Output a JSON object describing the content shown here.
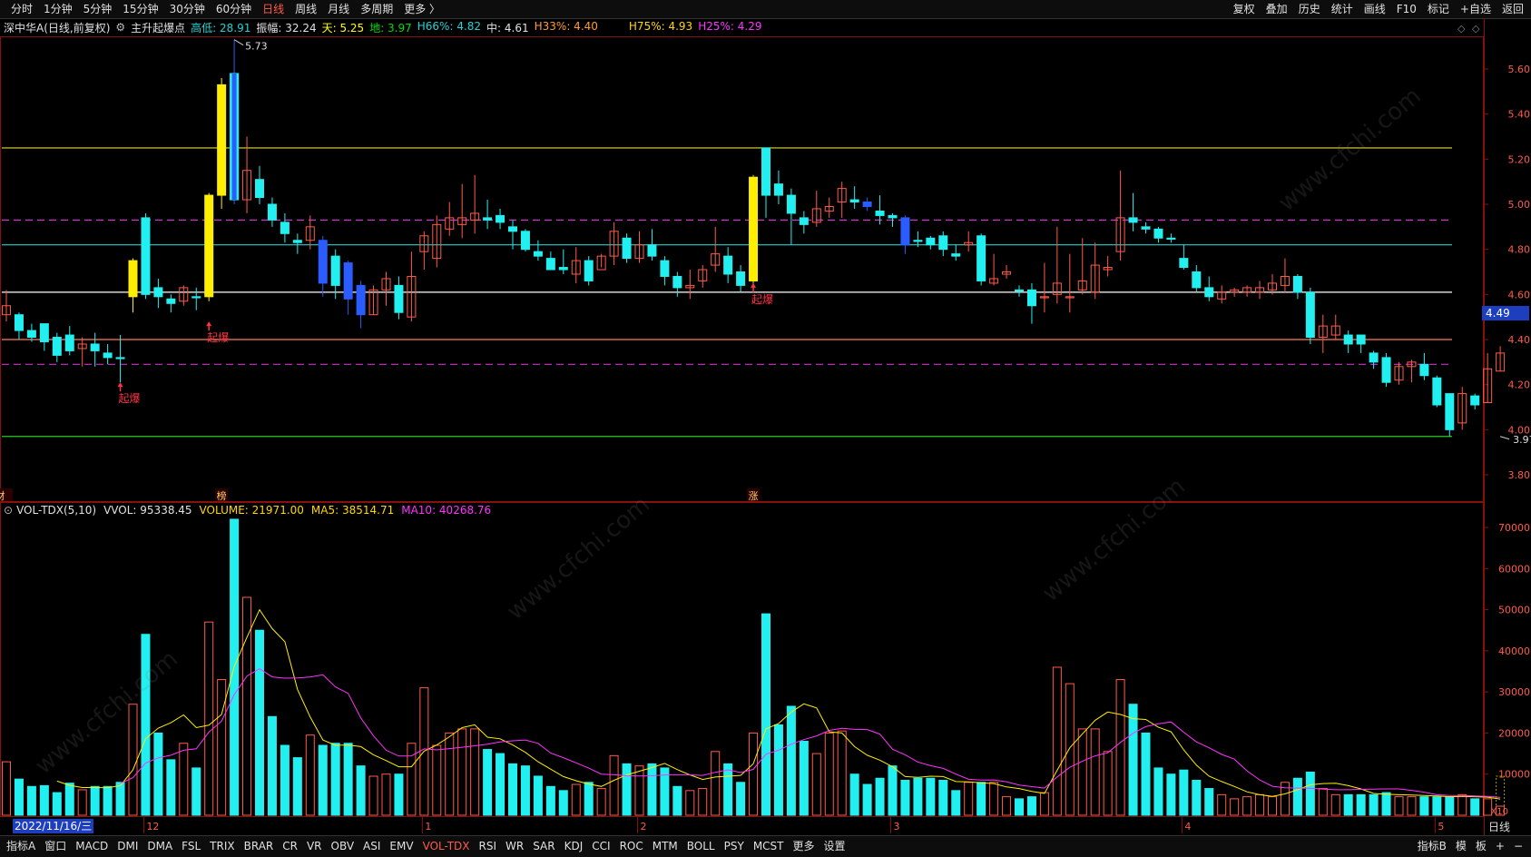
{
  "topbar": {
    "tabs": [
      "分时",
      "1分钟",
      "5分钟",
      "15分钟",
      "30分钟",
      "60分钟",
      "日线",
      "周线",
      "月线",
      "多周期",
      "更多 〉"
    ],
    "active_tab": 6,
    "right_buttons": [
      "复权",
      "叠加",
      "历史",
      "统计",
      "画线",
      "F10",
      "标记",
      "+自选",
      "返回"
    ]
  },
  "info": {
    "stock": "深中华A(日线,前复权)",
    "indicator": "主升起爆点",
    "items": [
      {
        "text": "高低: 28.91",
        "color": "#22d3d3"
      },
      {
        "text": "振幅: 32.24",
        "color": "#e0e0e0"
      },
      {
        "text": "天: 5.25",
        "color": "#ffff00"
      },
      {
        "text": "地: 3.97",
        "color": "#00dd00"
      },
      {
        "text": "H66%: 4.82",
        "color": "#22d3d3"
      },
      {
        "text": "中: 4.61",
        "color": "#e0e0e0"
      },
      {
        "text": "H33%: 4.40",
        "color": "#ff9a3a"
      },
      {
        "text": "H75%: 4.93",
        "color": "#ffd700"
      },
      {
        "text": "H25%: 4.29",
        "color": "#ff33ff"
      }
    ]
  },
  "vol_info": [
    {
      "text": "VOL-TDX(5,10)",
      "color": "#e0e0e0"
    },
    {
      "text": "VVOL: 95338.45",
      "color": "#e0e0e0"
    },
    {
      "text": "VOLUME: 21971.00",
      "color": "#ffd700"
    },
    {
      "text": "MA5: 38514.71",
      "color": "#ffd700"
    },
    {
      "text": "MA10: 40268.76",
      "color": "#ff33ff"
    }
  ],
  "price_axis": [
    "5.60",
    "5.40",
    "5.20",
    "5.00",
    "4.80",
    "4.60",
    "4.40",
    "4.20",
    "4.00",
    "3.80"
  ],
  "vol_axis": [
    "70000",
    "60000",
    "50000",
    "40000",
    "30000",
    "20000",
    "10000"
  ],
  "vol_unit": "X10",
  "current_price": "4.49",
  "high_label": "5.73",
  "low_label": "3.97",
  "signal_label": "起爆",
  "markers": [
    "榜",
    "涨",
    "财"
  ],
  "date_flag": "2022/11/16/三",
  "month_labels": [
    "12",
    "1",
    "2",
    "3",
    "4",
    "5"
  ],
  "period": "日线",
  "hlines": [
    {
      "price": 5.25,
      "color": "#e6d83a",
      "dash": false
    },
    {
      "price": 4.93,
      "color": "#cc33cc",
      "dash": true
    },
    {
      "price": 4.82,
      "color": "#22cfd0",
      "dash": false
    },
    {
      "price": 4.61,
      "color": "#ffffff",
      "dash": false
    },
    {
      "price": 4.4,
      "color": "#ff7a5a",
      "dash": false
    },
    {
      "price": 4.29,
      "color": "#cc33cc",
      "dash": true
    },
    {
      "price": 3.97,
      "color": "#22cc22",
      "dash": false
    }
  ],
  "bottom_tabs": [
    "指标A",
    "窗口",
    "MACD",
    "DMI",
    "DMA",
    "FSL",
    "TRIX",
    "BRAR",
    "CR",
    "VR",
    "OBV",
    "ASI",
    "EMV",
    "VOL-TDX",
    "RSI",
    "WR",
    "SAR",
    "KDJ",
    "CCI",
    "ROC",
    "MTM",
    "BOLL",
    "PSY",
    "MCST",
    "更多",
    "设置"
  ],
  "bottom_active": 13,
  "bottom_right": [
    "指标B",
    "模",
    "板",
    "+",
    "−"
  ],
  "chart_data": {
    "type": "candlestick",
    "ylim": [
      3.7,
      5.75
    ],
    "vol_ylim": [
      0,
      72000
    ],
    "candles": [
      [
        4.55,
        4.51,
        4.62,
        4.48,
        13000,
        "u"
      ],
      [
        4.51,
        4.44,
        4.52,
        4.4,
        8800,
        "d"
      ],
      [
        4.41,
        4.44,
        4.47,
        4.39,
        7000,
        "d"
      ],
      [
        4.47,
        4.39,
        4.47,
        4.35,
        7200,
        "d"
      ],
      [
        4.41,
        4.33,
        4.43,
        4.3,
        5500,
        "d"
      ],
      [
        4.42,
        4.35,
        4.46,
        4.33,
        7800,
        "d"
      ],
      [
        4.36,
        4.38,
        4.41,
        4.28,
        6200,
        "u"
      ],
      [
        4.38,
        4.35,
        4.43,
        4.28,
        7000,
        "d"
      ],
      [
        4.34,
        4.32,
        4.38,
        4.29,
        7000,
        "d"
      ],
      [
        4.32,
        4.32,
        4.42,
        4.21,
        8000,
        "d"
      ],
      [
        4.59,
        4.75,
        4.76,
        4.52,
        27000,
        "u"
      ],
      [
        4.94,
        4.6,
        4.96,
        4.58,
        44000,
        "d"
      ],
      [
        4.63,
        4.59,
        4.67,
        4.54,
        20000,
        "d"
      ],
      [
        4.58,
        4.56,
        4.6,
        4.52,
        13500,
        "d"
      ],
      [
        4.57,
        4.63,
        4.64,
        4.55,
        17500,
        "u"
      ],
      [
        4.59,
        4.59,
        4.63,
        4.53,
        11500,
        "d"
      ],
      [
        4.59,
        5.04,
        5.05,
        4.57,
        47000,
        "u"
      ],
      [
        5.04,
        5.53,
        5.56,
        4.98,
        33000,
        "u"
      ],
      [
        5.02,
        5.58,
        5.73,
        5.0,
        72000,
        "b"
      ],
      [
        5.02,
        5.15,
        5.3,
        4.96,
        53000,
        "u"
      ],
      [
        5.03,
        5.11,
        5.17,
        5.0,
        45000,
        "d"
      ],
      [
        5.0,
        4.93,
        5.03,
        4.9,
        24000,
        "d"
      ],
      [
        4.92,
        4.87,
        4.96,
        4.83,
        17000,
        "d"
      ],
      [
        4.84,
        4.83,
        4.87,
        4.78,
        14000,
        "d"
      ],
      [
        4.84,
        4.9,
        4.95,
        4.8,
        19500,
        "u"
      ],
      [
        4.84,
        4.65,
        4.86,
        4.59,
        17000,
        "b"
      ],
      [
        4.77,
        4.64,
        4.8,
        4.58,
        17500,
        "d"
      ],
      [
        4.74,
        4.58,
        4.75,
        4.51,
        17500,
        "b"
      ],
      [
        4.64,
        4.51,
        4.66,
        4.45,
        12000,
        "b"
      ],
      [
        4.51,
        4.62,
        4.64,
        4.51,
        9500,
        "u"
      ],
      [
        4.62,
        4.67,
        4.7,
        4.55,
        10000,
        "u"
      ],
      [
        4.64,
        4.52,
        4.68,
        4.49,
        10000,
        "d"
      ],
      [
        4.5,
        4.68,
        4.79,
        4.48,
        17500,
        "u"
      ],
      [
        4.79,
        4.86,
        4.88,
        4.71,
        31000,
        "u"
      ],
      [
        4.76,
        4.91,
        4.95,
        4.72,
        17000,
        "u"
      ],
      [
        4.89,
        4.94,
        5.01,
        4.86,
        20000,
        "u"
      ],
      [
        4.94,
        4.91,
        5.09,
        4.85,
        21000,
        "u"
      ],
      [
        4.93,
        4.96,
        5.13,
        4.87,
        21000,
        "u"
      ],
      [
        4.94,
        4.93,
        5.02,
        4.89,
        16000,
        "d"
      ],
      [
        4.95,
        4.92,
        4.98,
        4.89,
        15000,
        "d"
      ],
      [
        4.9,
        4.88,
        4.93,
        4.8,
        12500,
        "d"
      ],
      [
        4.88,
        4.8,
        4.89,
        4.79,
        12000,
        "d"
      ],
      [
        4.79,
        4.77,
        4.84,
        4.75,
        9500,
        "d"
      ],
      [
        4.76,
        4.71,
        4.79,
        4.71,
        7000,
        "d"
      ],
      [
        4.72,
        4.71,
        4.8,
        4.69,
        6000,
        "d"
      ],
      [
        4.69,
        4.75,
        4.81,
        4.65,
        7500,
        "u"
      ],
      [
        4.75,
        4.66,
        4.77,
        4.64,
        8000,
        "d"
      ],
      [
        4.71,
        4.77,
        4.78,
        4.72,
        6500,
        "u"
      ],
      [
        4.77,
        4.88,
        4.92,
        4.73,
        14500,
        "u"
      ],
      [
        4.85,
        4.76,
        4.87,
        4.74,
        12500,
        "d"
      ],
      [
        4.76,
        4.82,
        4.88,
        4.74,
        12000,
        "u"
      ],
      [
        4.82,
        4.77,
        4.89,
        4.75,
        12500,
        "d"
      ],
      [
        4.75,
        4.68,
        4.77,
        4.64,
        11500,
        "d"
      ],
      [
        4.68,
        4.63,
        4.7,
        4.59,
        7000,
        "d"
      ],
      [
        4.63,
        4.64,
        4.71,
        4.58,
        6000,
        "u"
      ],
      [
        4.66,
        4.71,
        4.73,
        4.63,
        6500,
        "u"
      ],
      [
        4.73,
        4.78,
        4.9,
        4.7,
        15500,
        "u"
      ],
      [
        4.77,
        4.69,
        4.81,
        4.65,
        12500,
        "d"
      ],
      [
        4.7,
        4.64,
        4.73,
        4.61,
        8000,
        "d"
      ],
      [
        4.66,
        5.12,
        5.13,
        4.63,
        20000,
        "u"
      ],
      [
        5.25,
        5.04,
        5.25,
        4.94,
        49000,
        "d"
      ],
      [
        5.09,
        5.04,
        5.15,
        5.0,
        22000,
        "d"
      ],
      [
        5.04,
        4.96,
        5.07,
        4.82,
        26500,
        "d"
      ],
      [
        4.94,
        4.91,
        4.97,
        4.87,
        18000,
        "d"
      ],
      [
        4.92,
        4.98,
        5.06,
        4.9,
        15000,
        "u"
      ],
      [
        4.97,
        4.99,
        5.03,
        4.94,
        20000,
        "u"
      ],
      [
        5.01,
        5.07,
        5.1,
        4.94,
        20500,
        "u"
      ],
      [
        5.02,
        5.01,
        5.08,
        4.98,
        10000,
        "d"
      ],
      [
        5.01,
        4.99,
        5.03,
        4.97,
        7500,
        "b"
      ],
      [
        4.97,
        4.95,
        5.04,
        4.91,
        9000,
        "d"
      ],
      [
        4.95,
        4.94,
        4.96,
        4.9,
        12000,
        "d"
      ],
      [
        4.94,
        4.82,
        4.95,
        4.78,
        8500,
        "b"
      ],
      [
        4.84,
        4.84,
        4.88,
        4.81,
        9000,
        "d"
      ],
      [
        4.85,
        4.82,
        4.86,
        4.8,
        9000,
        "d"
      ],
      [
        4.86,
        4.8,
        4.88,
        4.77,
        8500,
        "d"
      ],
      [
        4.78,
        4.77,
        4.82,
        4.75,
        6000,
        "d"
      ],
      [
        4.82,
        4.83,
        4.88,
        4.79,
        8000,
        "u"
      ],
      [
        4.86,
        4.66,
        4.87,
        4.64,
        8000,
        "d"
      ],
      [
        4.65,
        4.67,
        4.78,
        4.64,
        8000,
        "u"
      ],
      [
        4.7,
        4.69,
        4.73,
        4.67,
        4500,
        "u"
      ],
      [
        4.62,
        4.62,
        4.64,
        4.59,
        4000,
        "d"
      ],
      [
        4.62,
        4.55,
        4.65,
        4.47,
        4500,
        "d"
      ],
      [
        4.59,
        4.59,
        4.74,
        4.52,
        5500,
        "u"
      ],
      [
        4.6,
        4.65,
        4.9,
        4.56,
        36000,
        "u"
      ],
      [
        4.59,
        4.59,
        4.78,
        4.52,
        32000,
        "u"
      ],
      [
        4.62,
        4.66,
        4.85,
        4.6,
        21000,
        "u"
      ],
      [
        4.61,
        4.73,
        4.83,
        4.58,
        21000,
        "u"
      ],
      [
        4.72,
        4.71,
        4.77,
        4.68,
        15500,
        "u"
      ],
      [
        4.79,
        4.94,
        5.15,
        4.75,
        33000,
        "u"
      ],
      [
        4.94,
        4.92,
        5.05,
        4.88,
        27000,
        "d"
      ],
      [
        4.89,
        4.9,
        4.92,
        4.87,
        20000,
        "d"
      ],
      [
        4.89,
        4.85,
        4.9,
        4.83,
        11500,
        "d"
      ],
      [
        4.85,
        4.85,
        4.87,
        4.83,
        10000,
        "d"
      ],
      [
        4.76,
        4.72,
        4.82,
        4.71,
        11000,
        "d"
      ],
      [
        4.7,
        4.63,
        4.73,
        4.61,
        8500,
        "d"
      ],
      [
        4.63,
        4.59,
        4.68,
        4.57,
        6500,
        "d"
      ],
      [
        4.58,
        4.61,
        4.64,
        4.56,
        5000,
        "u"
      ],
      [
        4.61,
        4.62,
        4.63,
        4.59,
        4000,
        "u"
      ],
      [
        4.61,
        4.63,
        4.64,
        4.59,
        4500,
        "u"
      ],
      [
        4.63,
        4.61,
        4.66,
        4.58,
        5000,
        "u"
      ],
      [
        4.62,
        4.65,
        4.69,
        4.6,
        4500,
        "u"
      ],
      [
        4.64,
        4.68,
        4.76,
        4.61,
        8000,
        "u"
      ],
      [
        4.68,
        4.61,
        4.69,
        4.58,
        9000,
        "d"
      ],
      [
        4.61,
        4.41,
        4.63,
        4.38,
        10500,
        "d"
      ],
      [
        4.41,
        4.46,
        4.51,
        4.34,
        6500,
        "u"
      ],
      [
        4.46,
        4.42,
        4.51,
        4.4,
        5000,
        "u"
      ],
      [
        4.42,
        4.38,
        4.44,
        4.34,
        5000,
        "d"
      ],
      [
        4.42,
        4.38,
        4.42,
        4.34,
        5000,
        "d"
      ],
      [
        4.34,
        4.3,
        4.35,
        4.27,
        5000,
        "d"
      ],
      [
        4.32,
        4.21,
        4.34,
        4.19,
        5500,
        "d"
      ],
      [
        4.22,
        4.28,
        4.3,
        4.2,
        4500,
        "u"
      ],
      [
        4.28,
        4.3,
        4.31,
        4.21,
        4500,
        "u"
      ],
      [
        4.29,
        4.24,
        4.34,
        4.22,
        4500,
        "d"
      ],
      [
        4.23,
        4.11,
        4.24,
        4.1,
        4500,
        "d"
      ],
      [
        4.16,
        4.0,
        4.16,
        3.97,
        4500,
        "d"
      ],
      [
        4.03,
        4.16,
        4.19,
        4.0,
        5000,
        "u"
      ],
      [
        4.15,
        4.11,
        4.16,
        4.09,
        4000,
        "d"
      ],
      [
        4.12,
        4.27,
        4.34,
        4.12,
        4000,
        "u"
      ],
      [
        4.26,
        4.34,
        4.37,
        4.26,
        2200,
        "u"
      ]
    ]
  }
}
